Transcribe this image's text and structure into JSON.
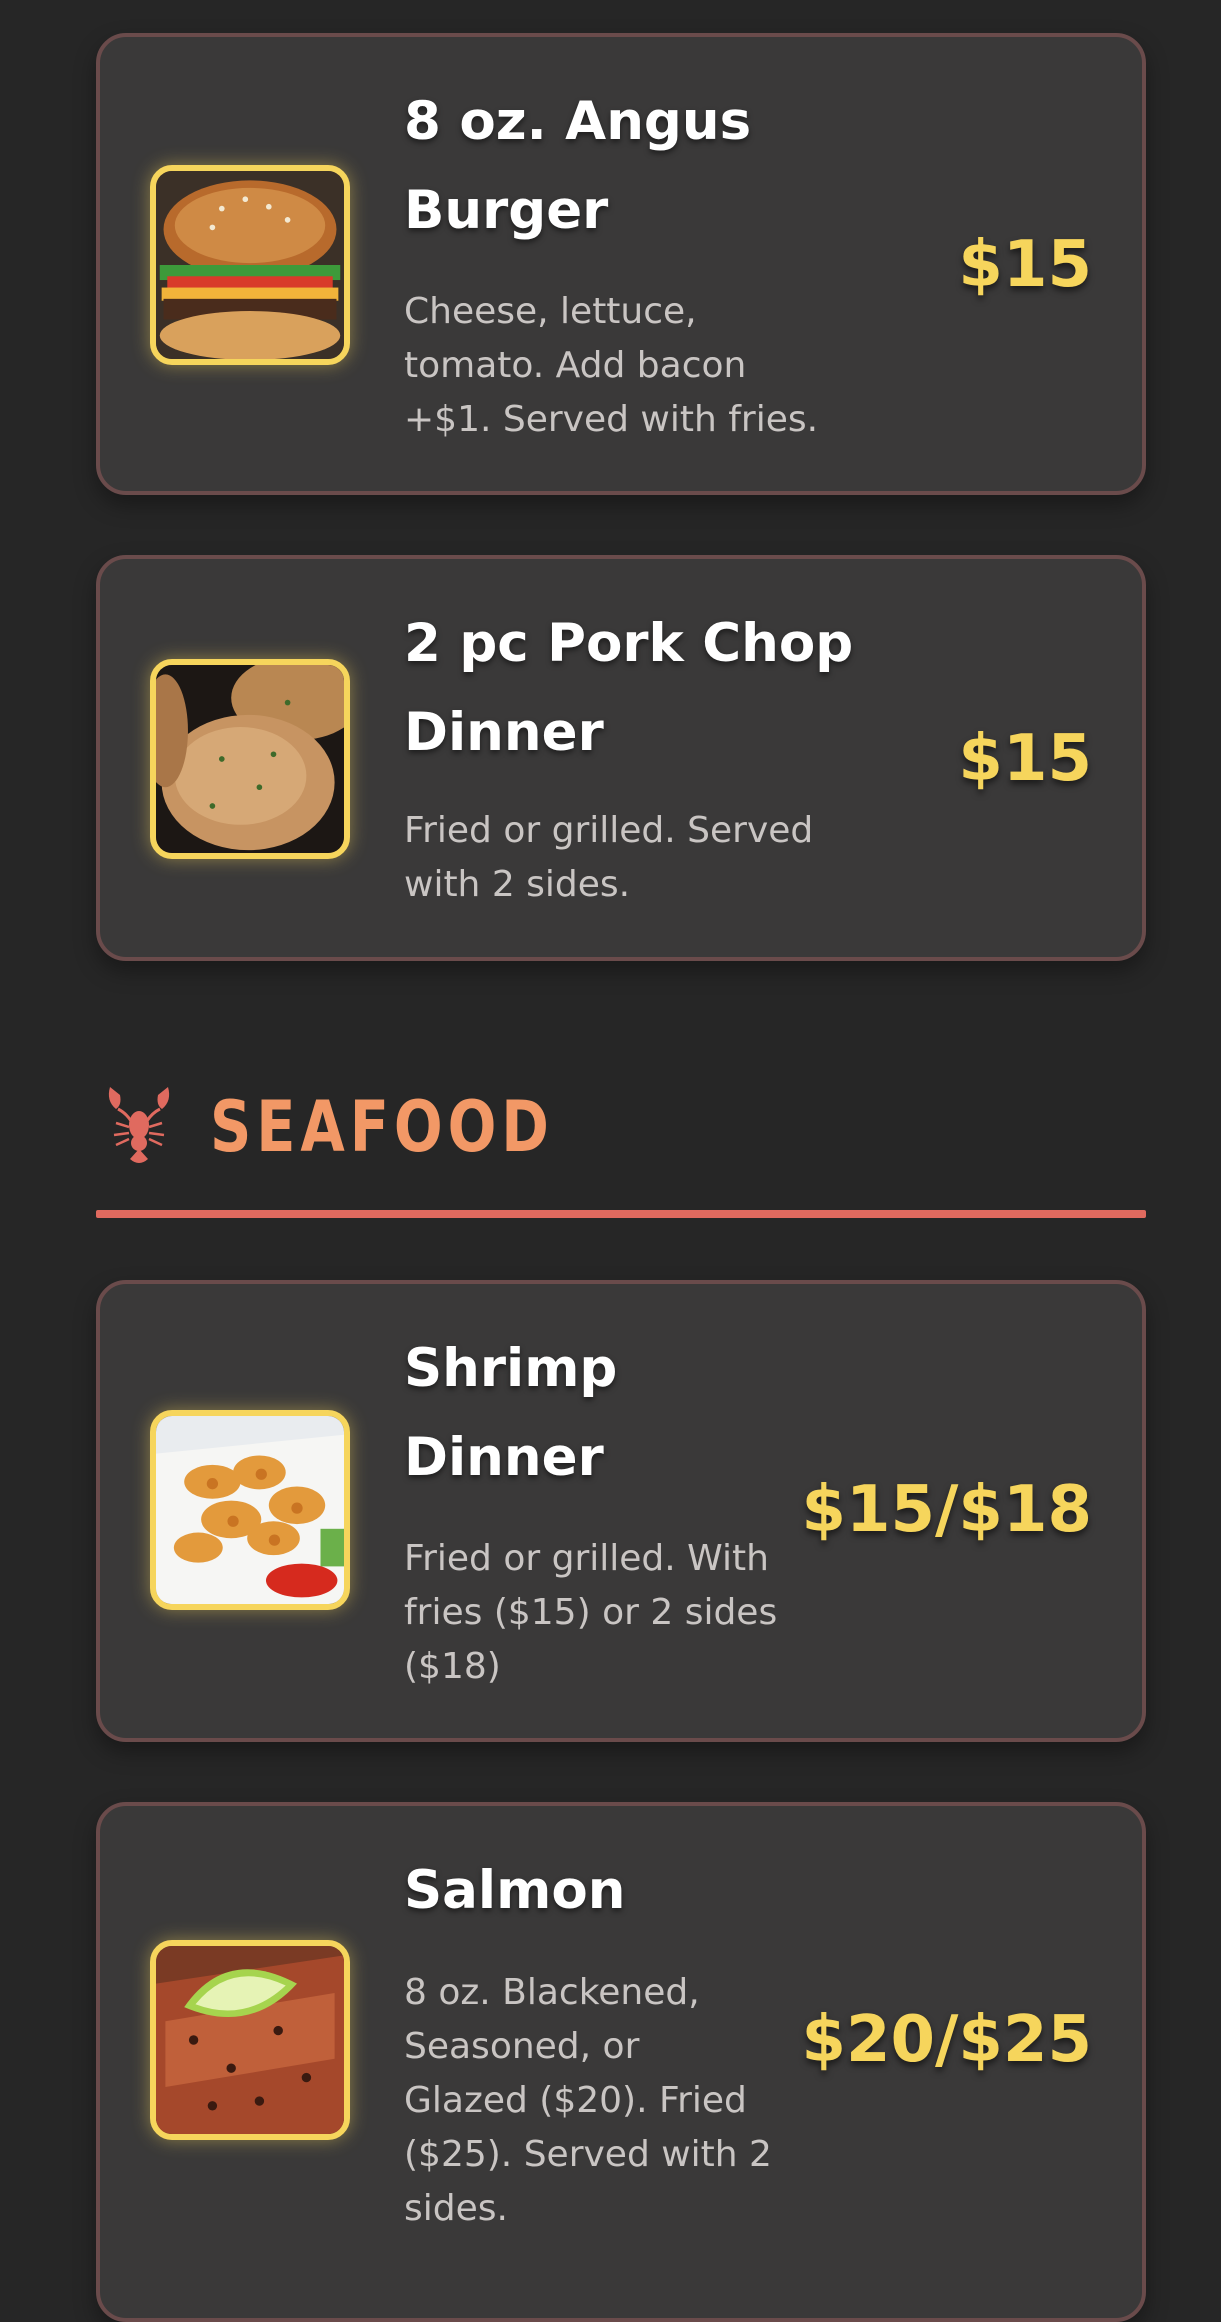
{
  "menu_items_top": [
    {
      "title": "8 oz. Angus\nBurger",
      "description": "Cheese, lettuce,\ntomato. Add bacon\n+$1. Served with fries.",
      "price": "$15",
      "image": "burger-photo"
    },
    {
      "title": "2 pc Pork Chop\nDinner",
      "description": "Fried or grilled. Served\nwith 2 sides.",
      "price": "$15",
      "image": "pork-chop-photo"
    }
  ],
  "section": {
    "title": "SEAFOOD",
    "icon": "lobster-icon"
  },
  "menu_items_seafood": [
    {
      "title": "Shrimp\nDinner",
      "description": "Fried or grilled. With\nfries ($15) or 2 sides\n($18)",
      "price": "$15/$18",
      "image": "shrimp-photo"
    },
    {
      "title": "Salmon",
      "description": "8 oz. Blackened,\nSeasoned, or\nGlazed ($20). Fried\n($25). Served with 2\nsides.",
      "price": "$20/$25",
      "image": "salmon-photo"
    }
  ],
  "colors": {
    "background": "#262626",
    "card": "#3a3939",
    "card_border": "#6a4b4b",
    "price": "#f6d55c",
    "section_title": "#f29866",
    "section_rule": "#e06a5f"
  }
}
